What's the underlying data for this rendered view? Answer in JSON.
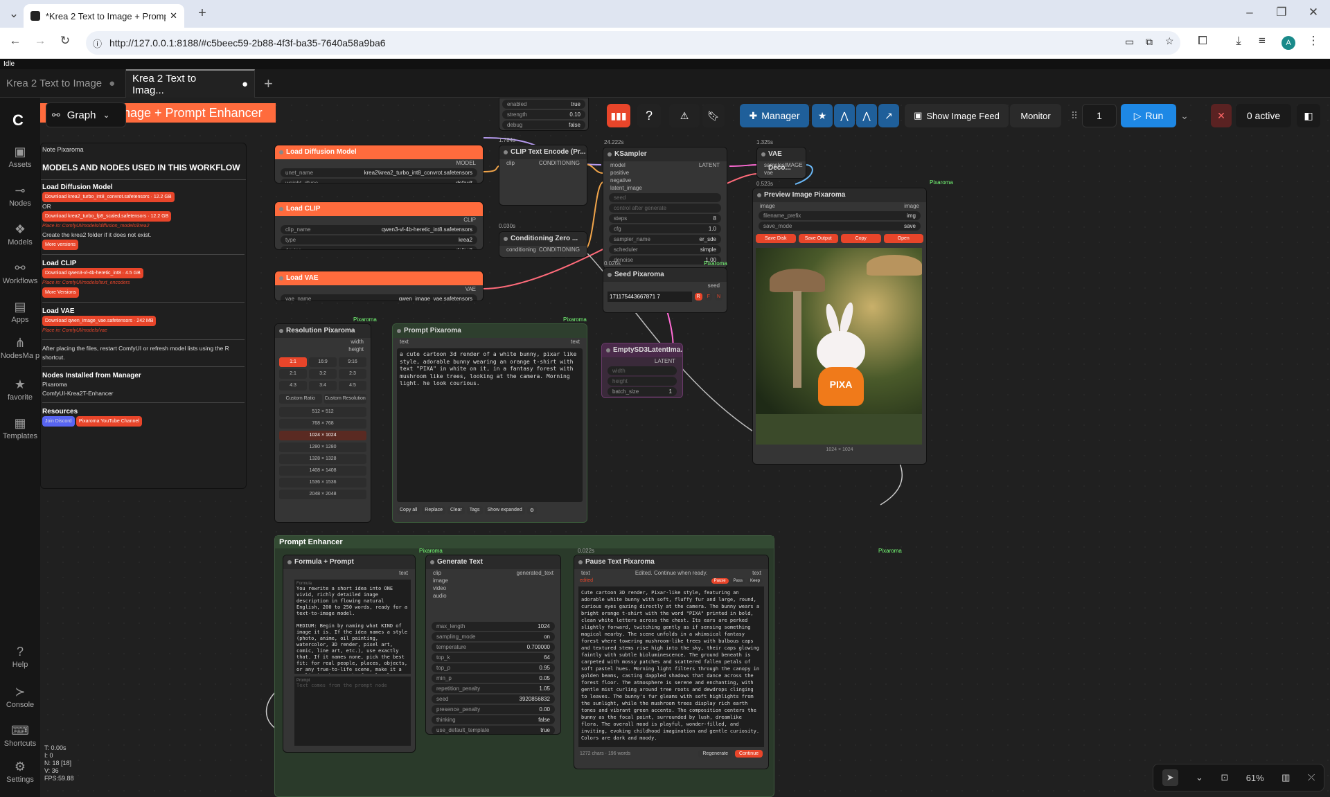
{
  "browser": {
    "tab1": "*Krea 2 Text to Image + Prompt",
    "url": "http://127.0.0.1:8188/#c5beec59-2b88-4f3f-ba35-7640a58a9ba6",
    "avatar": "A"
  },
  "status": "Idle",
  "workflow_tabs": [
    "Krea 2 Text to Image",
    "Krea 2 Text to Imag..."
  ],
  "sidebar": {
    "assets": "Assets",
    "nodes": "Nodes",
    "models": "Models",
    "workflows": "Workflows",
    "apps": "Apps",
    "nodesmap": "NodesMa p",
    "favorite": "favorite",
    "templates": "Templates",
    "help": "Help",
    "console": "Console",
    "shortcuts": "Shortcuts",
    "settings": "Settings"
  },
  "toolbar": {
    "graph": "Graph",
    "banner": "nage + Prompt Enhancer",
    "manager": "Manager",
    "show_feed": "Show Image Feed",
    "monitor": "Monitor",
    "count": "1",
    "run": "Run",
    "active": "0 active"
  },
  "note": {
    "title": "Note Pixaroma",
    "heading": "MODELS AND NODES USED IN THIS WORKFLOW",
    "s1": "Load Diffusion Model",
    "b1": "Download krea2_turbo_int8_convrot.safetensors · 12.2 GB",
    "or": "OR",
    "b2": "Download krea2_turbo_fp8_scaled.safetensors · 12.2 GB",
    "p1": "Place in: ComfyUI/models/diffusion_models/krea2",
    "create": "Create the krea2 folder if it does not exist.",
    "more1": "More versions",
    "s2": "Load CLIP",
    "b3": "Download qwen3-vl-4b-heretic_int8 · 4.5 GB",
    "p2": "Place in: ComfyUI/models/text_encoders",
    "more2": "More Versions",
    "s3": "Load VAE",
    "b4": "Download qwen_image_vae.safetensors · 242 MB",
    "p3": "Place in: ComfyUI/models/vae",
    "after": "After placing the files, restart ComfyUI or refresh model lists using the R shortcut.",
    "s4": "Nodes Installed from Manager",
    "n1": "Pixaroma",
    "n2": "ComfyUI-Krea2T-Enhancer",
    "s5": "Resources",
    "discord": "Join Discord",
    "yt": "Pixaroma YouTube Channel"
  },
  "brand": "Pixaroma",
  "load_diff": {
    "title": "Load Diffusion Model",
    "out": "MODEL",
    "unet": "unet_name",
    "unet_v": "krea2\\krea2_turbo_int8_convrot.safetensors",
    "wd": "weight_dtype",
    "wd_v": "default"
  },
  "load_clip": {
    "title": "Load CLIP",
    "out": "CLIP",
    "cn": "clip_name",
    "cn_v": "qwen3-vl-4b-heretic_int8.safetensors",
    "type": "type",
    "type_v": "krea2",
    "dev": "device",
    "dev_v": "default"
  },
  "load_vae": {
    "title": "Load VAE",
    "out": "VAE",
    "vn": "vae_name",
    "vn_v": "qwen_image_vae.safetensors"
  },
  "lora": {
    "enabled": "enabled",
    "enabled_v": "true",
    "strength": "strength",
    "strength_v": "0.10",
    "debug": "debug",
    "debug_v": "false"
  },
  "clip_enc": {
    "time": "1.784s",
    "title": "CLIP Text Encode (Pr...",
    "clip": "clip",
    "out": "CONDITIONING"
  },
  "cond_zero": {
    "time": "0.030s",
    "title": "Conditioning Zero ...",
    "in": "conditioning",
    "out": "CONDITIONING"
  },
  "ksampler": {
    "time": "24.222s",
    "title": "KSampler",
    "model": "model",
    "positive": "positive",
    "negative": "negative",
    "latent": "latent_image",
    "out": "LATENT",
    "seed": "seed",
    "cag": "control after generate",
    "steps": "steps",
    "steps_v": "8",
    "cfg": "cfg",
    "cfg_v": "1.0",
    "sampler": "sampler_name",
    "sampler_v": "er_sde",
    "scheduler": "scheduler",
    "scheduler_v": "simple",
    "denoise": "denoise",
    "denoise_v": "1.00"
  },
  "vae_dec": {
    "time": "1.325s",
    "title": "VAE Deco...",
    "samples": "samples",
    "vae": "vae",
    "out": "IMAGE"
  },
  "preview": {
    "time": "0.523s",
    "title": "Preview Image Pixaroma",
    "image": "image",
    "prefix": "filename_prefix",
    "prefix_v": "img",
    "mode": "save_mode",
    "mode_v": "save",
    "b1": "Save Disk",
    "b2": "Save Output",
    "b3": "Copy",
    "b4": "Open",
    "dims": "1024 × 1024",
    "pixa": "PIXA"
  },
  "seed": {
    "time": "0.026s",
    "title": "Seed Pixaroma",
    "out": "seed",
    "value": "171175443667871 7",
    "r": "R",
    "f": "F",
    "n": "N"
  },
  "resolution": {
    "title": "Resolution Pixaroma",
    "w": "width",
    "h": "height",
    "ratios": [
      "1:1",
      "16:9",
      "9:16",
      "2:1",
      "3:2",
      "2:3",
      "4:3",
      "3:4",
      "4:5"
    ],
    "cr": "Custom Ratio",
    "cres": "Custom Resolution",
    "sizes": [
      "512 × 512",
      "768 × 768",
      "1024 × 1024",
      "1280 × 1280",
      "1328 × 1328",
      "1408 × 1408",
      "1536 × 1536",
      "2048 × 2048"
    ]
  },
  "prompt": {
    "title": "Prompt Pixaroma",
    "label": "text",
    "out": "text",
    "text": "a cute cartoon 3d render of a white bunny, pixar like style, adorable bunny wearing an orange t-shirt with text \"PIXA\" in white on it, in a fantasy forest with mushroom like trees, looking at the camera. Morning light. he look courious.",
    "b1": "Copy all",
    "b2": "Replace",
    "b3": "Clear",
    "b4": "Tags",
    "b5": "Show expanded"
  },
  "empty": {
    "title": "EmptySD3LatentIma...",
    "out": "LATENT",
    "width": "width",
    "height": "height",
    "batch": "batch_size",
    "batch_v": "1"
  },
  "group": {
    "title": "Prompt Enhancer"
  },
  "formula": {
    "title": "Formula + Prompt",
    "out": "text",
    "label1": "Formula",
    "text": "You rewrite a short idea into ONE vivid, richly detailed image description in flowing natural English, 200 to 250 words, ready for a text-to-image model.\n\nMEDIUM: Begin by naming what KIND of image it is. If the idea names a style (photo, anime, oil painting, watercolor, 3D render, pixel art, comic, line art, etc.), use exactly that. If it names none, pick the best fit: for real people, places, objects, or any true-to-life scene, make it a realistic photograph; for clearly cartoon, stylized, or",
    "label2": "Prompt",
    "placeholder": "Text comes from the prompt node"
  },
  "gen": {
    "title": "Generate Text",
    "clip": "clip",
    "image": "image",
    "video": "video",
    "audio": "audio",
    "out": "generated_text",
    "w": [
      [
        "max_length",
        "1024"
      ],
      [
        "sampling_mode",
        "on"
      ],
      [
        "temperature",
        "0.700000"
      ],
      [
        "top_k",
        "64"
      ],
      [
        "top_p",
        "0.95"
      ],
      [
        "min_p",
        "0.05"
      ],
      [
        "repetition_penalty",
        "1.05"
      ],
      [
        "seed",
        "3920856832"
      ],
      [
        "presence_penalty",
        "0.00"
      ],
      [
        "thinking",
        "false"
      ],
      [
        "use_default_template",
        "true"
      ]
    ]
  },
  "pause": {
    "time": "0.022s",
    "title": "Pause Text Pixaroma",
    "in": "text",
    "out": "text",
    "msg": "Edited. Continue when ready.",
    "edited": "edited",
    "p": "Pause",
    "pass": "Pass",
    "keep": "Keep",
    "text": "Cute cartoon 3D render, Pixar-like style, featuring an adorable white bunny with soft, fluffy fur and large, round, curious eyes gazing directly at the camera. The bunny wears a bright orange t-shirt with the word \"PIXA\" printed in bold, clean white letters across the chest. Its ears are perked slightly forward, twitching gently as if sensing something magical nearby. The scene unfolds in a whimsical fantasy forest where towering mushroom-like trees with bulbous caps and textured stems rise high into the sky, their caps glowing faintly with subtle bioluminescence. The ground beneath is carpeted with mossy patches and scattered fallen petals of soft pastel hues. Morning light filters through the canopy in golden beams, casting dappled shadows that dance across the forest floor. The atmosphere is serene and enchanting, with gentle mist curling around tree roots and dewdrops clinging to leaves. The bunny's fur gleams with soft highlights from the sunlight, while the mushroom trees display rich earth tones and vibrant green accents. The composition centers the bunny as the focal point, surrounded by lush, dreamlike flora. The overall mood is playful, wonder-filled, and inviting, evoking childhood imagination and gentle curiosity.\nColors are dark and moody.",
    "stats": "1272 chars · 196 words",
    "regen": "Regenerate",
    "cont": "Continue"
  },
  "stats": {
    "t": "T: 0.00s",
    "i": "I: 0",
    "n": "N: 18 [18]",
    "v": "V: 36",
    "fps": "FPS:59.88"
  },
  "zoom": "61%"
}
